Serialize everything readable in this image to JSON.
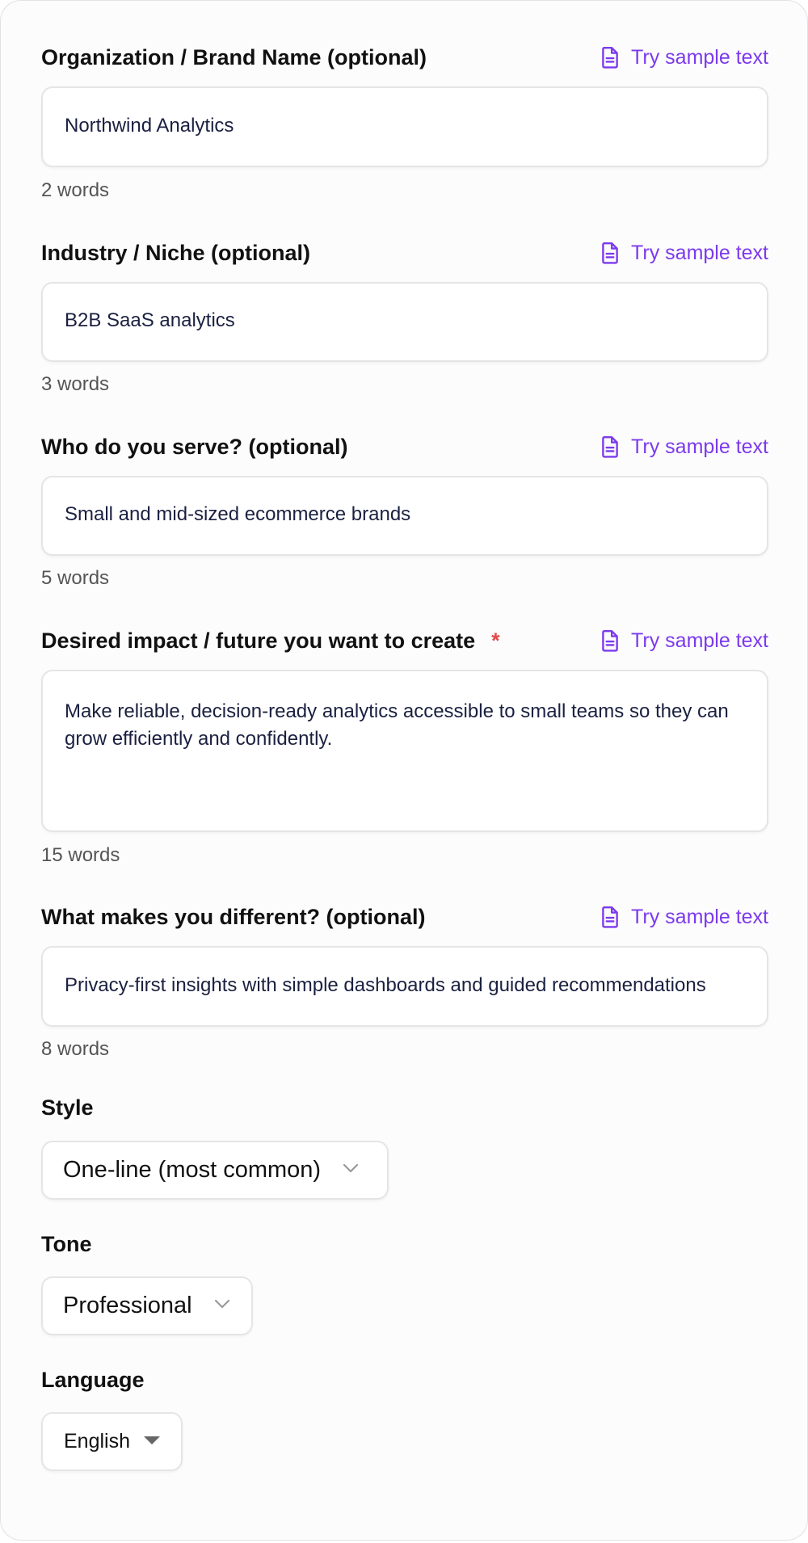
{
  "fields": [
    {
      "label": "Organization / Brand Name (optional)",
      "value": "Northwind Analytics",
      "count": "2 words",
      "sample": "Try sample text"
    },
    {
      "label": "Industry / Niche (optional)",
      "value": "B2B SaaS analytics",
      "count": "3 words",
      "sample": "Try sample text"
    },
    {
      "label": "Who do you serve? (optional)",
      "value": "Small and mid-sized ecommerce brands",
      "count": "5 words",
      "sample": "Try sample text"
    },
    {
      "label": "Desired impact / future you want to create",
      "required_mark": "*",
      "value": "Make reliable, decision-ready analytics accessible to small teams so they can grow efficiently and confidently.",
      "count": "15 words",
      "sample": "Try sample text"
    },
    {
      "label": "What makes you different? (optional)",
      "value": "Privacy-first insights with simple dashboards and guided recommendations",
      "count": "8 words",
      "sample": "Try sample text"
    }
  ],
  "style": {
    "label": "Style",
    "selected": "One-line (most common)"
  },
  "tone": {
    "label": "Tone",
    "selected": "Professional"
  },
  "language": {
    "label": "Language",
    "selected": "English"
  },
  "colors": {
    "accent": "#7c3aed",
    "required": "#e04848"
  },
  "icons": {
    "sample": "document-icon",
    "dropdown": "chevron-down-icon",
    "language_dropdown": "caret-down-icon"
  }
}
